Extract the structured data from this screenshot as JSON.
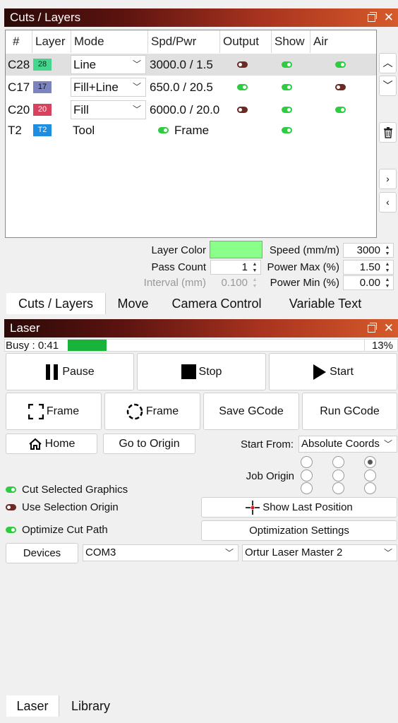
{
  "cuts_panel": {
    "title": "Cuts / Layers",
    "columns": [
      "#",
      "Layer",
      "Mode",
      "Spd/Pwr",
      "Output",
      "Show",
      "Air"
    ],
    "rows": [
      {
        "id": "C28",
        "layer": "28",
        "color": "#44d68d",
        "mode": "Line",
        "spdpwr": "3000.0 / 1.5",
        "output": false,
        "show": true,
        "air": true
      },
      {
        "id": "C17",
        "layer": "17",
        "color": "#7b84bf",
        "mode": "Fill+Line",
        "spdpwr": "650.0 / 20.5",
        "output": true,
        "show": true,
        "air": false
      },
      {
        "id": "C20",
        "layer": "20",
        "color": "#d9425f",
        "mode": "Fill",
        "spdpwr": "6000.0 / 20.0",
        "output": false,
        "show": true,
        "air": true
      },
      {
        "id": "T2",
        "layer": "T2",
        "color": "#1e8fe0",
        "mode": "Tool",
        "spdpwr": "Frame",
        "output": true,
        "show": true,
        "air": null
      }
    ],
    "layer_color_label": "Layer Color",
    "layer_color_value": "#8aff8a",
    "pass_count_label": "Pass Count",
    "pass_count": "1",
    "interval_label": "Interval (mm)",
    "interval": "0.100",
    "speed_label": "Speed (mm/m)",
    "speed": "3000",
    "power_max_label": "Power Max (%)",
    "power_max": "1.50",
    "power_min_label": "Power Min (%)",
    "power_min": "0.00"
  },
  "top_tabs": [
    "Cuts / Layers",
    "Move",
    "Camera Control",
    "Variable Text"
  ],
  "laser_panel": {
    "title": "Laser",
    "status": "Busy : 0:41",
    "progress_percent": 13,
    "progress_label": "13%",
    "pause": "Pause",
    "stop": "Stop",
    "start": "Start",
    "frame1": "Frame",
    "frame2": "Frame",
    "save_gcode": "Save GCode",
    "run_gcode": "Run GCode",
    "home": "Home",
    "go_to_origin": "Go to Origin",
    "start_from_label": "Start From:",
    "start_from_value": "Absolute Coords",
    "job_origin_label": "Job Origin",
    "cut_selected": "Cut Selected Graphics",
    "use_selection_origin": "Use Selection Origin",
    "optimize_cut_path": "Optimize Cut Path",
    "show_last_position": "Show Last Position",
    "optimization_settings": "Optimization Settings",
    "devices": "Devices",
    "port": "COM3",
    "device_name": "Ortur Laser Master 2"
  },
  "bottom_tabs": [
    "Laser",
    "Library"
  ],
  "colors": {
    "toggle_on": "#2ecc40",
    "toggle_off": "#6b2a26",
    "progress": "#17b33a"
  }
}
